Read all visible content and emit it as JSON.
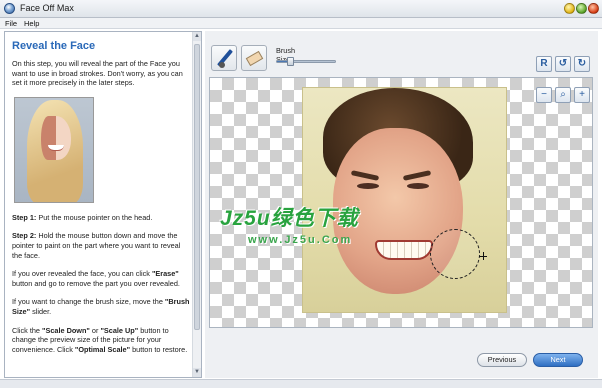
{
  "window": {
    "title": "Face Off Max"
  },
  "menu": {
    "items": [
      "File",
      "Help"
    ]
  },
  "instructions": {
    "heading": "Reveal the Face",
    "intro": "On this step, you will reveal the part of the Face you want to use in broad strokes. Don't worry, as you can set it more precisely in the later steps.",
    "step1_label": "Step 1:",
    "step1_text": " Put the mouse pointer on the head.",
    "step2_label": "Step 2:",
    "step2_text": " Hold the mouse button down and move the pointer to paint on the part where you want to reveal the face.",
    "erase_pre": "If you over revealed the face, you can click ",
    "erase_btn": "\"Erase\"",
    "erase_post": " button and go to remove the part you over revealed.",
    "brush_pre": "If you want to change the brush size, move the ",
    "brush_btn": "\"Brush Size\"",
    "brush_post": " slider.",
    "scale_pre": "Click the ",
    "scale_down": "\"Scale Down\"",
    "scale_or": " or ",
    "scale_up": "\"Scale Up\"",
    "scale_mid": " button to change the preview size of the picture for your convenience. Click ",
    "scale_opt": "\"Optimal Scale\"",
    "scale_post": " button to restore."
  },
  "toolbar": {
    "brush_icon": "brush-icon",
    "eraser_icon": "eraser-icon",
    "brush_size_label": "Brush Size",
    "brush_size_value": 0.2
  },
  "rotate_buttons": [
    "R",
    "↺",
    "↻"
  ],
  "zoom_buttons": [
    "−",
    "⌕",
    "+"
  ],
  "watermark": {
    "text": "Jz5u绿色下载",
    "url": "www.Jz5u.Com"
  },
  "nav": {
    "previous": "Previous",
    "next": "Next"
  },
  "colors": {
    "accent": "#2a69b8",
    "next_button": "#2f6fc2",
    "watermark": "#29a33f"
  }
}
